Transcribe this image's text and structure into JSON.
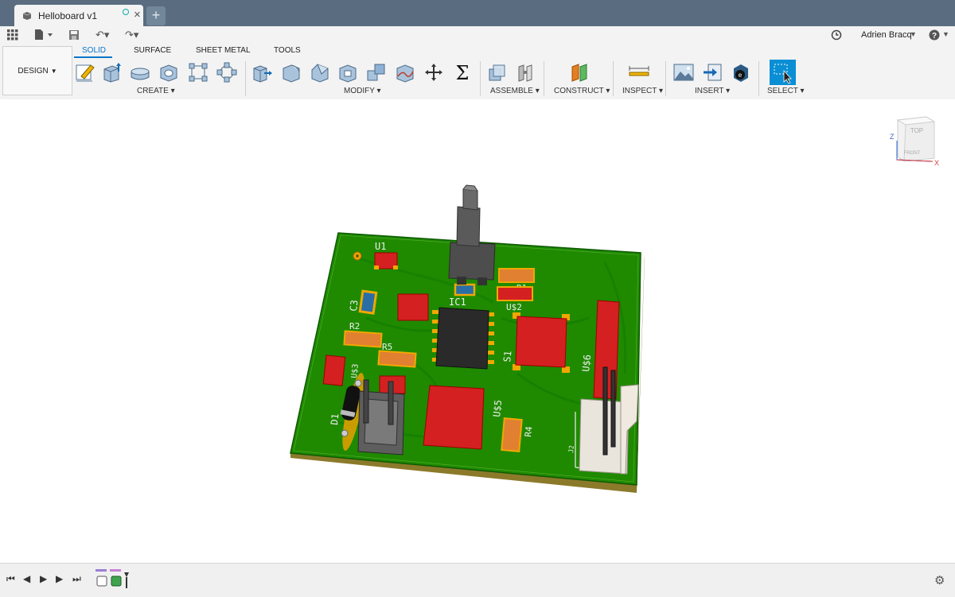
{
  "app": {
    "tab_title": "Helloboard v1",
    "user_name": "Adrien Bracq",
    "accent": "#0a76c8"
  },
  "ribbon": {
    "workspace": "DESIGN",
    "tabs": [
      "SOLID",
      "SURFACE",
      "SHEET METAL",
      "TOOLS"
    ],
    "active_tab": "SOLID",
    "groups": [
      "CREATE",
      "MODIFY",
      "ASSEMBLE",
      "CONSTRUCT",
      "INSPECT",
      "INSERT",
      "SELECT"
    ]
  },
  "viewcube": {
    "top": "TOP",
    "front": "FRONT",
    "z": "Z",
    "x": "X"
  },
  "board": {
    "labels": [
      "U1",
      "C3",
      "R2",
      "R5",
      "IC1",
      "R1",
      "U$2",
      "S1",
      "U$6",
      "U$3",
      "D1",
      "U$5",
      "R4",
      "J2"
    ],
    "colors": {
      "pcb": "#1f8a00",
      "pad": "#f0a800",
      "component": "#d42020",
      "resistor": "#e08030",
      "capacitor": "#2a6ea5",
      "chip": "#2a2a2a"
    }
  },
  "timeline": {
    "icons": [
      "first-icon",
      "prev-icon",
      "play-icon",
      "next-icon",
      "last-icon"
    ]
  }
}
